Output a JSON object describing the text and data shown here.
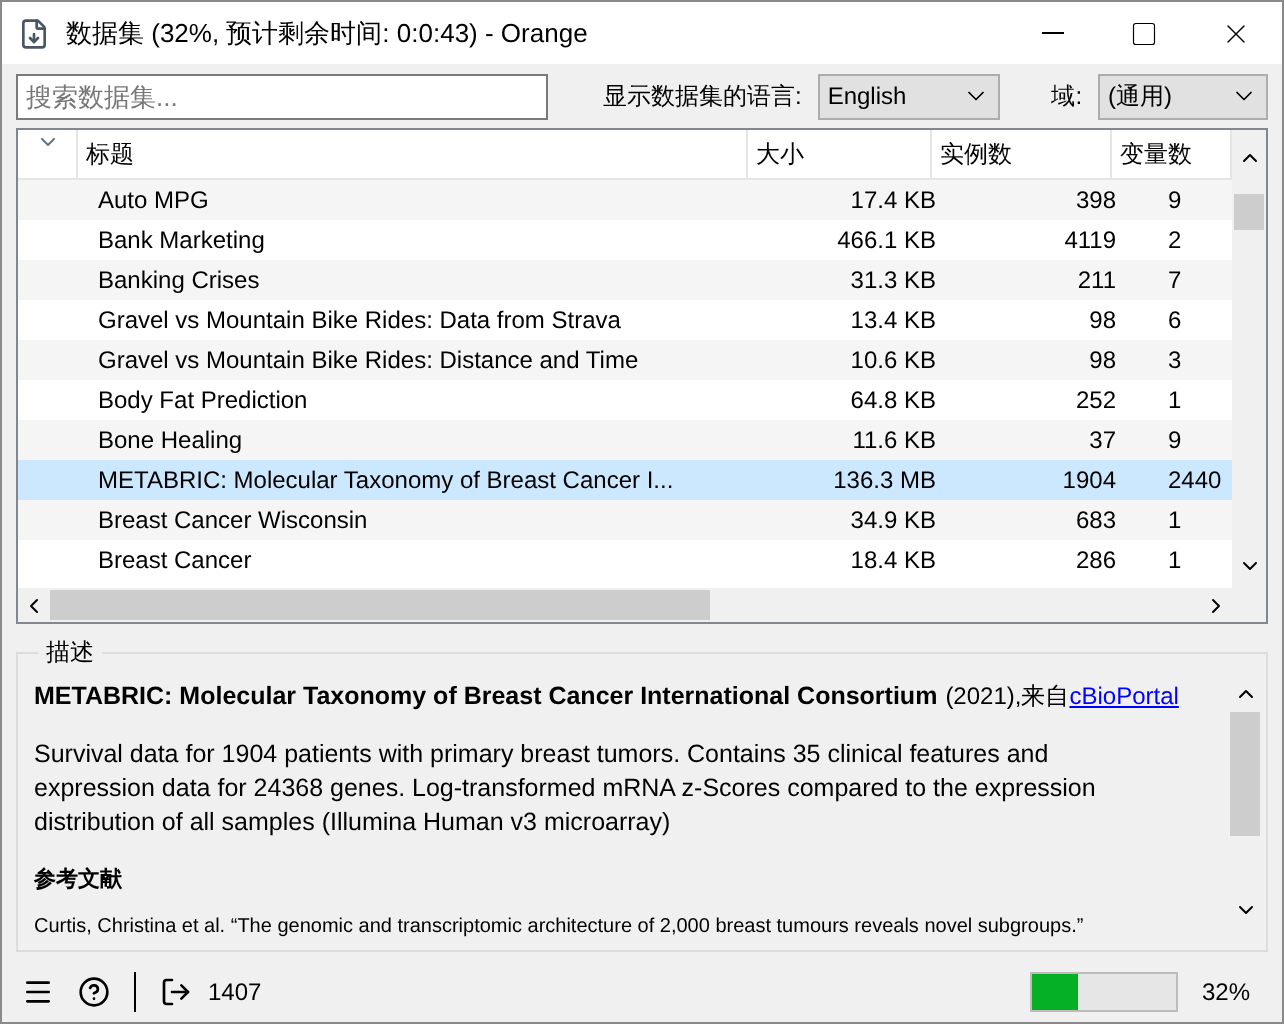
{
  "window": {
    "title": "数据集 (32%, 预计剩余时间: 0:0:43) - Orange"
  },
  "search": {
    "placeholder": "搜索数据集..."
  },
  "language": {
    "label": "显示数据集的语言:",
    "value": "English"
  },
  "domain": {
    "label": "域:",
    "value": "(通用)"
  },
  "table": {
    "columns": [
      "标题",
      "大小",
      "实例数",
      "变量数"
    ],
    "rows": [
      {
        "cells": [
          "Auto MPG",
          "17.4 KB",
          "398",
          "9"
        ],
        "selected": false
      },
      {
        "cells": [
          "Bank Marketing",
          "466.1 KB",
          "4119",
          "2"
        ],
        "selected": false
      },
      {
        "cells": [
          "Banking Crises",
          "31.3 KB",
          "211",
          "7"
        ],
        "selected": false
      },
      {
        "cells": [
          "Gravel vs Mountain Bike Rides: Data from Strava",
          "13.4 KB",
          "98",
          "6"
        ],
        "selected": false
      },
      {
        "cells": [
          "Gravel vs Mountain Bike Rides: Distance and Time",
          "10.6 KB",
          "98",
          "3"
        ],
        "selected": false
      },
      {
        "cells": [
          "Body Fat Prediction",
          "64.8 KB",
          "252",
          "1"
        ],
        "selected": false
      },
      {
        "cells": [
          "Bone Healing",
          "11.6 KB",
          "37",
          "9"
        ],
        "selected": false
      },
      {
        "cells": [
          "METABRIC: Molecular Taxonomy of Breast Cancer I...",
          "136.3 MB",
          "1904",
          "2440"
        ],
        "selected": true
      },
      {
        "cells": [
          "Breast Cancer Wisconsin",
          "34.9 KB",
          "683",
          "1"
        ],
        "selected": false
      },
      {
        "cells": [
          "Breast Cancer",
          "18.4 KB",
          "286",
          "1"
        ],
        "selected": false
      }
    ]
  },
  "description": {
    "label": "描述",
    "title": "METABRIC: Molecular Taxonomy of Breast Cancer International Consortium",
    "source": "(2021),来自",
    "link": "cBioPortal",
    "text": "Survival data for 1904 patients with primary breast tumors. Contains 35 clinical features and expression data for 24368 genes. Log-transformed mRNA z-Scores compared to the expression distribution of all samples (Illumina Human v3 microarray)",
    "references_heading": "参考文献",
    "reference": "Curtis, Christina et al. “The genomic and transcriptomic architecture of 2,000 breast tumours reveals novel subgroups.”"
  },
  "status_bar": {
    "count": "1407",
    "progress": {
      "level": 0.32,
      "reading": "32%"
    }
  }
}
